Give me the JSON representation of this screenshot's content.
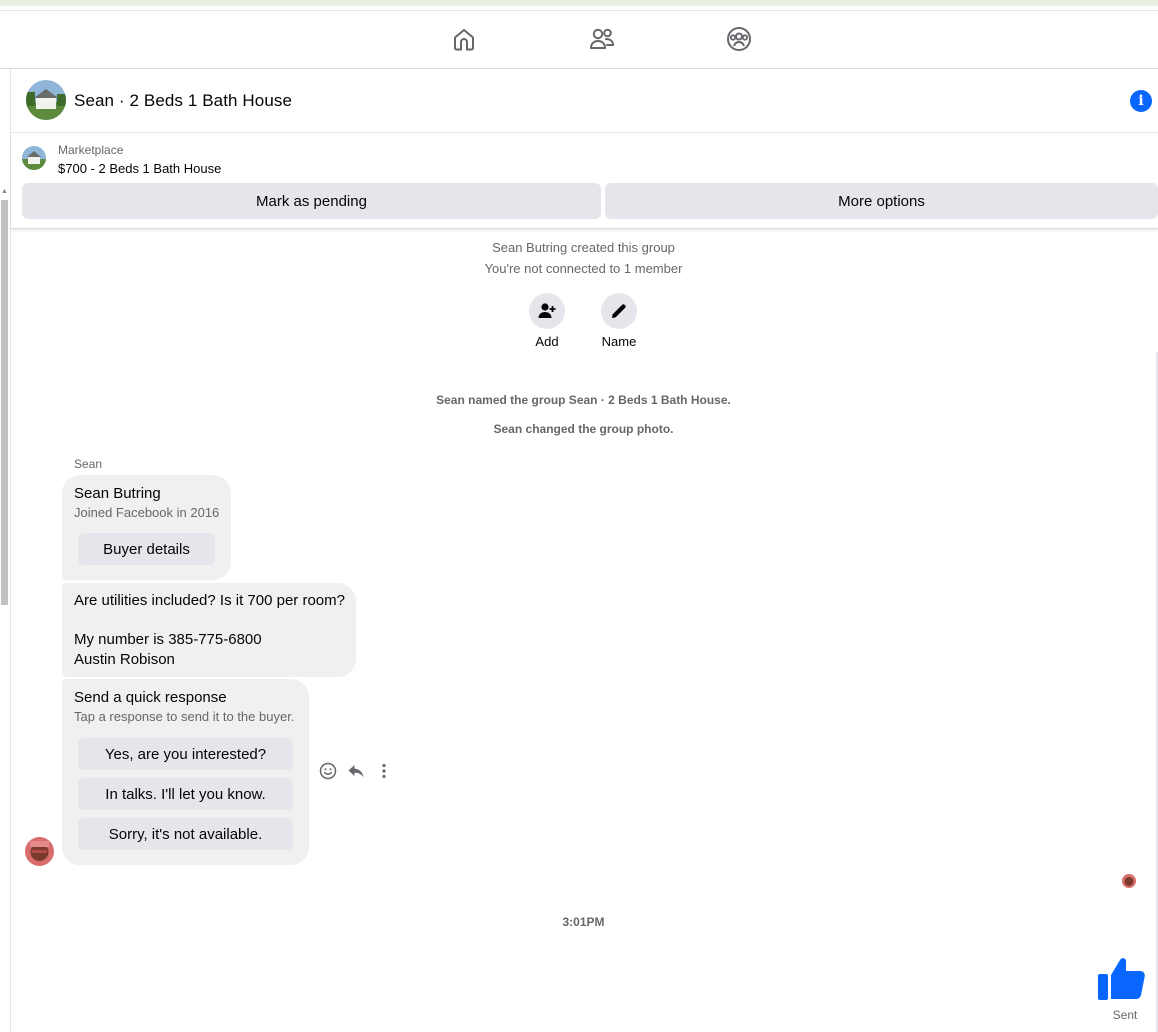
{
  "nav": {
    "icons": [
      "home-icon",
      "friends-icon",
      "groups-icon"
    ]
  },
  "header": {
    "title": "Sean · 2 Beds 1 Bath House",
    "info_icon": "info-icon",
    "info_glyph": "i"
  },
  "marketplace": {
    "label": "Marketplace",
    "listing": "$700 - 2 Beds 1 Bath House",
    "mark_pending_label": "Mark as pending",
    "more_options_label": "More options"
  },
  "group_info": {
    "created": "Sean Butring created this group",
    "not_connected": "You're not connected to 1 member",
    "add_label": "Add",
    "name_label": "Name",
    "named_event": "Sean named the group Sean · 2 Beds 1 Bath House.",
    "photo_event": "Sean changed the group photo."
  },
  "conversation": {
    "sender_name": "Sean",
    "profile_card": {
      "name": "Sean Butring",
      "joined": "Joined Facebook in 2016",
      "button": "Buyer details"
    },
    "message": {
      "line1": "Are utilities included? Is it 700 per room?",
      "line2": "My number is 385-775-6800",
      "line3": "Austin Robison"
    },
    "quick_response": {
      "title": "Send a quick response",
      "subtitle": "Tap a response to send it to the buyer.",
      "options": [
        "Yes, are you interested?",
        "In talks. I'll let you know.",
        "Sorry, it's not available."
      ]
    },
    "actions": [
      "smiley-icon",
      "reply-icon",
      "more-vertical-icon"
    ],
    "timestamp": "3:01PM",
    "sent_label": "Sent"
  },
  "colors": {
    "accent": "#0866ff",
    "bubble": "#f0f0f0",
    "button": "#e4e6eb",
    "secondary_text": "#65676b"
  }
}
